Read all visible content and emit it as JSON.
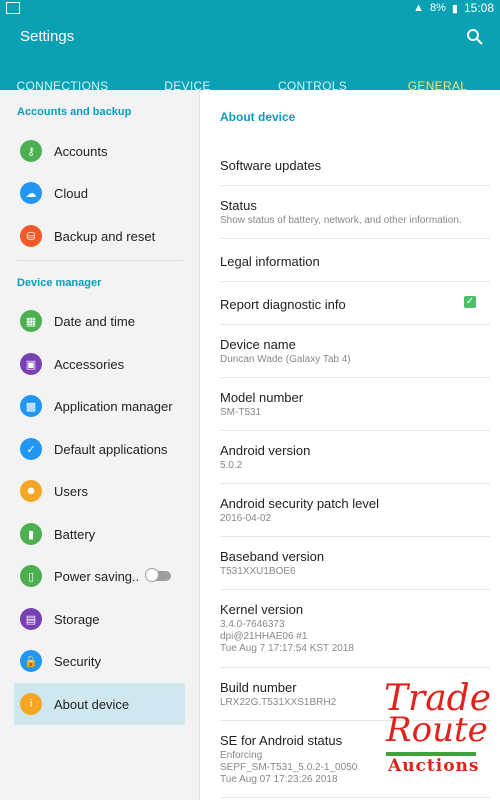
{
  "statusbar": {
    "battery": "8%",
    "time": "15:08"
  },
  "appbar": {
    "title": "Settings"
  },
  "tabs": [
    {
      "label": "CONNECTIONS"
    },
    {
      "label": "DEVICE"
    },
    {
      "label": "CONTROLS"
    },
    {
      "label": "GENERAL"
    }
  ],
  "left": {
    "section1": "Accounts and backup",
    "section2": "Device manager",
    "items": [
      {
        "label": "Accounts",
        "icon": "key-icon",
        "color": "#4caf50"
      },
      {
        "label": "Cloud",
        "icon": "cloud-icon",
        "color": "#2196f3"
      },
      {
        "label": "Backup and reset",
        "icon": "backup-icon",
        "color": "#f05a28"
      },
      {
        "label": "Date and time",
        "icon": "calendar-icon",
        "color": "#4caf50"
      },
      {
        "label": "Accessories",
        "icon": "accessories-icon",
        "color": "#7b3fb4"
      },
      {
        "label": "Application manager",
        "icon": "apps-icon",
        "color": "#2196f3"
      },
      {
        "label": "Default applications",
        "icon": "default-apps-icon",
        "color": "#2196f3"
      },
      {
        "label": "Users",
        "icon": "users-icon",
        "color": "#f5a623"
      },
      {
        "label": "Battery",
        "icon": "battery-icon",
        "color": "#4caf50"
      },
      {
        "label": "Power saving..",
        "icon": "power-saving-icon",
        "color": "#4caf50"
      },
      {
        "label": "Storage",
        "icon": "storage-icon",
        "color": "#7b3fb4"
      },
      {
        "label": "Security",
        "icon": "lock-icon",
        "color": "#2196f3"
      },
      {
        "label": "About device",
        "icon": "info-icon",
        "color": "#f5a623"
      }
    ]
  },
  "right": {
    "title": "About device",
    "rows": [
      {
        "label": "Software updates",
        "sub": ""
      },
      {
        "label": "Status",
        "sub": "Show status of battery, network, and other information."
      },
      {
        "label": "Legal information",
        "sub": ""
      },
      {
        "label": "Report diagnostic info",
        "sub": ""
      },
      {
        "label": "Device name",
        "sub": "Duncan Wade (Galaxy Tab 4)"
      },
      {
        "label": "Model number",
        "sub": "SM-T531"
      },
      {
        "label": "Android version",
        "sub": "5.0.2"
      },
      {
        "label": "Android security patch level",
        "sub": "2016-04-02"
      },
      {
        "label": "Baseband version",
        "sub": "T531XXU1BOE6"
      },
      {
        "label": "Kernel version",
        "sub": "3.4.0-7646373\ndpi@21HHAE06 #1\nTue Aug 7 17:17:54 KST 2018"
      },
      {
        "label": "Build number",
        "sub": "LRX22G.T531XXS1BRH2"
      },
      {
        "label": "SE for Android status",
        "sub": "Enforcing\nSEPF_SM-T531_5.0.2-1_0050\nTue Aug 07 17:23:26 2018"
      }
    ]
  },
  "watermark": {
    "line1": "Trade",
    "line2": "Route",
    "line3": "Auctions"
  }
}
